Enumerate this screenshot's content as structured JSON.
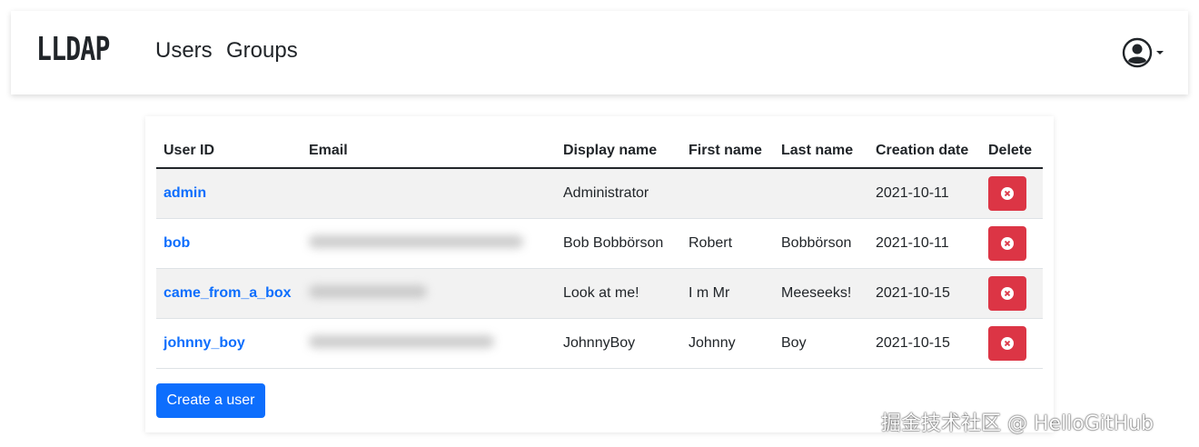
{
  "navbar": {
    "brand": "LLDAP",
    "links": [
      "Users",
      "Groups"
    ],
    "user_menu_icon": "user-circle-icon"
  },
  "table": {
    "headers": [
      "User ID",
      "Email",
      "Display name",
      "First name",
      "Last name",
      "Creation date",
      "Delete"
    ],
    "rows": [
      {
        "user_id": "admin",
        "email": "",
        "display_name": "Administrator",
        "first_name": "",
        "last_name": "",
        "created": "2021-10-11"
      },
      {
        "user_id": "bob",
        "email": "",
        "display_name": "Bob Bobbörson",
        "first_name": "Robert",
        "last_name": "Bobbörson",
        "created": "2021-10-11"
      },
      {
        "user_id": "came_from_a_box",
        "email": "",
        "display_name": "Look at me!",
        "first_name": "I m Mr",
        "last_name": "Meeseeks!",
        "created": "2021-10-15"
      },
      {
        "user_id": "johnny_boy",
        "email": "",
        "display_name": "JohnnyBoy",
        "first_name": "Johnny",
        "last_name": "Boy",
        "created": "2021-10-15"
      }
    ],
    "delete_icon": "x-circle-icon"
  },
  "create_button": "Create a user",
  "watermark": "掘金技术社区 @ HelloGitHub",
  "colors": {
    "primary": "#0d6efd",
    "danger": "#dc3545",
    "text": "#212529"
  }
}
